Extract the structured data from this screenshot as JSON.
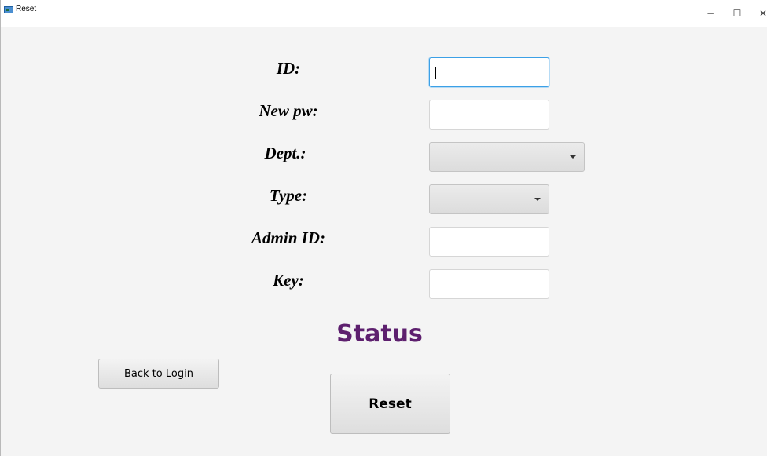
{
  "window": {
    "title": "Reset",
    "minimize": "−",
    "maximize": "☐",
    "close": "✕"
  },
  "form": {
    "id_label": "ID:",
    "id_value": "",
    "newpw_label": "New pw:",
    "newpw_value": "",
    "dept_label": "Dept.:",
    "dept_value": "",
    "type_label": "Type:",
    "type_value": "",
    "adminid_label": "Admin ID:",
    "adminid_value": "",
    "key_label": "Key:",
    "key_value": ""
  },
  "status_text": "Status",
  "buttons": {
    "back_label": "Back to Login",
    "reset_label": "Reset"
  },
  "colors": {
    "status": "#5d1f6e",
    "focus_border": "#3ca0e6"
  }
}
